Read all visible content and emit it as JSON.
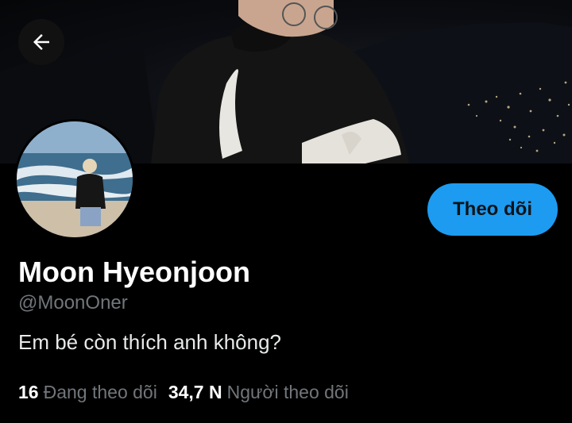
{
  "header": {
    "back_icon": "arrow-left-icon",
    "banner_image": "banner-photo"
  },
  "profile": {
    "avatar_image": "avatar-photo",
    "display_name": "Moon Hyeonjoon",
    "handle": "@MoonOner",
    "bio": "Em bé còn thích anh không?",
    "follow_label": "Theo dõi"
  },
  "stats": {
    "following_count": "16",
    "following_label": "Đang theo dõi",
    "followers_count": "34,7 N",
    "followers_label": "Người theo dõi"
  },
  "colors": {
    "accent": "#1d9bf0",
    "background": "#000000",
    "secondary_text": "#71767b",
    "primary_text": "#e7e9ea"
  }
}
